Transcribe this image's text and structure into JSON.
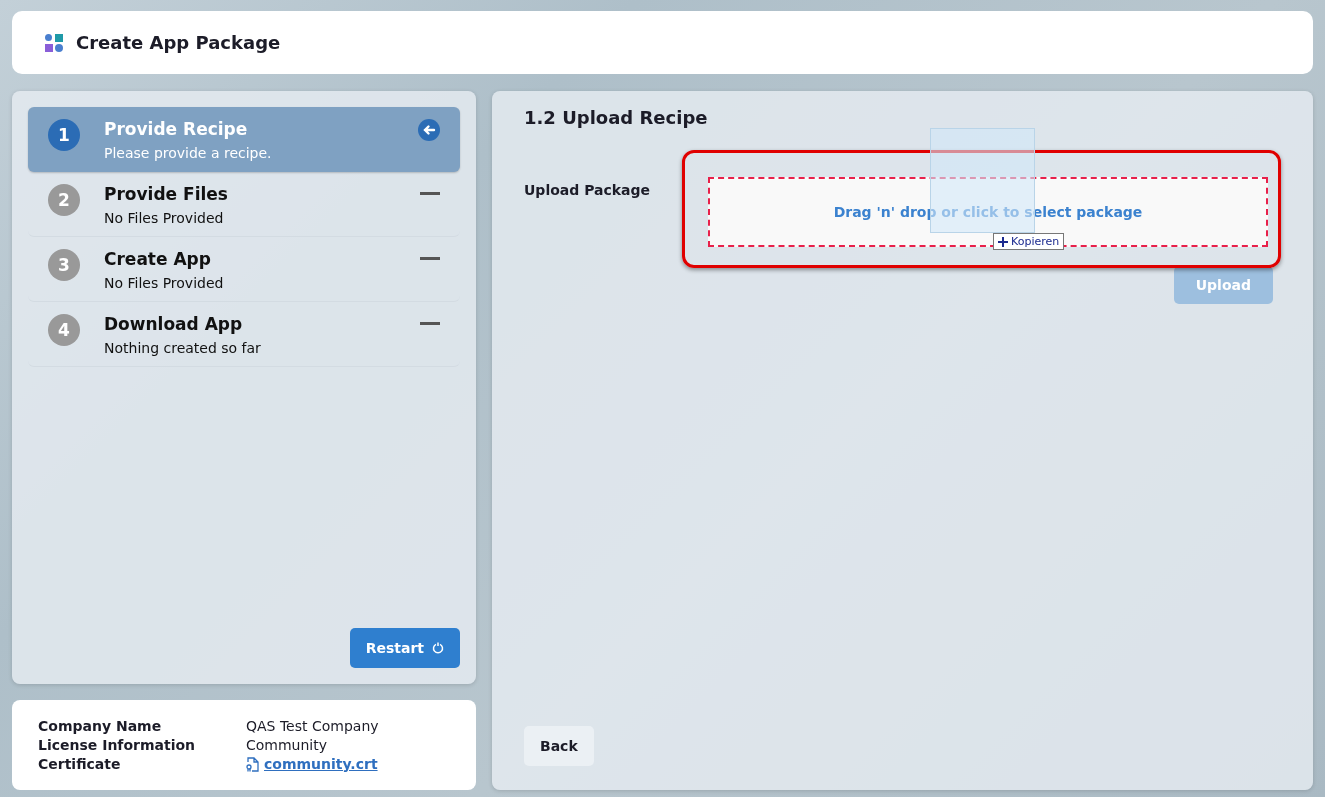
{
  "header": {
    "title": "Create App Package"
  },
  "steps": [
    {
      "number": "1",
      "title": "Provide Recipe",
      "subtitle": "Please provide a recipe.",
      "selected": true
    },
    {
      "number": "2",
      "title": "Provide Files",
      "subtitle": "No Files Provided",
      "selected": false
    },
    {
      "number": "3",
      "title": "Create App",
      "subtitle": "No Files Provided",
      "selected": false
    },
    {
      "number": "4",
      "title": "Download App",
      "subtitle": "Nothing created so far",
      "selected": false
    }
  ],
  "restart_button": "Restart",
  "info": [
    {
      "label": "Company Name",
      "value": "QAS Test Company",
      "kind": "text"
    },
    {
      "label": "License Information",
      "value": "Community",
      "kind": "text"
    },
    {
      "label": "Certificate",
      "value": "community.crt",
      "kind": "link"
    }
  ],
  "content": {
    "title": "1.2 Upload Recipe",
    "field_label": "Upload Package",
    "dropzone": "Drag 'n' drop or click to select package",
    "drag_tooltip": "Kopieren",
    "upload_button": {
      "label": "Upload",
      "disabled": true
    },
    "back_button": "Back"
  }
}
